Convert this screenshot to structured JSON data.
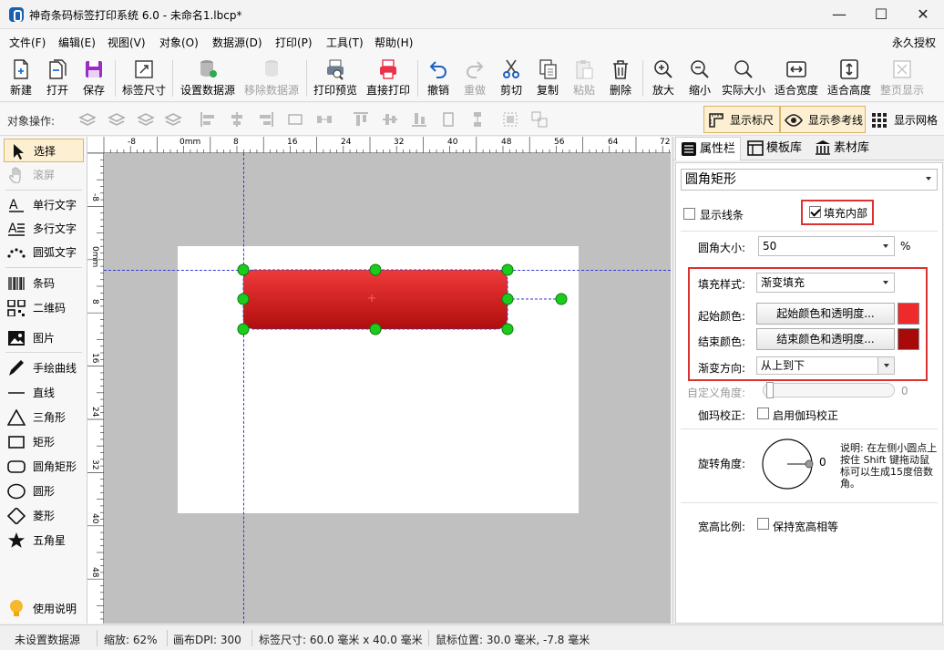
{
  "window": {
    "title": "神奇条码标签打印系统 6.0 - 未命名1.lbcp*",
    "controls": {
      "minimize": "—",
      "maximize": "☐",
      "close": "✕"
    }
  },
  "menu": {
    "items": [
      "文件(F)",
      "编辑(E)",
      "视图(V)",
      "对象(O)",
      "数据源(D)",
      "打印(P)",
      "工具(T)",
      "帮助(H)"
    ],
    "right": "永久授权"
  },
  "toolbar": {
    "buttons": [
      {
        "label": "新建",
        "icon": "new-file-icon",
        "enabled": true
      },
      {
        "label": "打开",
        "icon": "open-file-icon",
        "enabled": true
      },
      {
        "label": "保存",
        "icon": "save-icon",
        "enabled": true
      },
      {
        "label": "标签尺寸",
        "icon": "label-size-icon",
        "enabled": true
      },
      {
        "label": "设置数据源",
        "icon": "database-icon",
        "enabled": true
      },
      {
        "label": "移除数据源",
        "icon": "remove-database-icon",
        "enabled": false
      },
      {
        "label": "打印预览",
        "icon": "print-preview-icon",
        "enabled": true
      },
      {
        "label": "直接打印",
        "icon": "printer-icon",
        "enabled": true
      },
      {
        "label": "撤销",
        "icon": "undo-icon",
        "enabled": true
      },
      {
        "label": "重做",
        "icon": "redo-icon",
        "enabled": false
      },
      {
        "label": "剪切",
        "icon": "scissors-icon",
        "enabled": true
      },
      {
        "label": "复制",
        "icon": "copy-icon",
        "enabled": true
      },
      {
        "label": "粘贴",
        "icon": "paste-icon",
        "enabled": false
      },
      {
        "label": "删除",
        "icon": "trash-icon",
        "enabled": true
      },
      {
        "label": "放大",
        "icon": "zoom-in-icon",
        "enabled": true
      },
      {
        "label": "缩小",
        "icon": "zoom-out-icon",
        "enabled": true
      },
      {
        "label": "实际大小",
        "icon": "zoom-actual-icon",
        "enabled": true
      },
      {
        "label": "适合宽度",
        "icon": "fit-width-icon",
        "enabled": true
      },
      {
        "label": "适合高度",
        "icon": "fit-height-icon",
        "enabled": true
      },
      {
        "label": "整页显示",
        "icon": "fit-page-icon",
        "enabled": false
      }
    ]
  },
  "object_bar": {
    "label": "对象操作:",
    "toggles": [
      {
        "label": "显示标尺",
        "icon": "ruler-icon",
        "active": true
      },
      {
        "label": "显示参考线",
        "icon": "eye-icon",
        "active": true
      },
      {
        "label": "显示网格",
        "icon": "grid-icon",
        "active": false
      }
    ]
  },
  "left_tools": {
    "items": [
      {
        "label": "选择",
        "icon": "pointer-icon",
        "selected": true,
        "enabled": true
      },
      {
        "label": "滚屏",
        "icon": "hand-icon",
        "selected": false,
        "enabled": false
      },
      {
        "label": "单行文字",
        "icon": "single-text-icon",
        "selected": false,
        "enabled": true
      },
      {
        "label": "多行文字",
        "icon": "multi-text-icon",
        "selected": false,
        "enabled": true
      },
      {
        "label": "圆弧文字",
        "icon": "arc-text-icon",
        "selected": false,
        "enabled": true
      },
      {
        "label": "条码",
        "icon": "barcode-icon",
        "selected": false,
        "enabled": true
      },
      {
        "label": "二维码",
        "icon": "qrcode-icon",
        "selected": false,
        "enabled": true
      },
      {
        "label": "图片",
        "icon": "image-icon",
        "selected": false,
        "enabled": true
      },
      {
        "label": "手绘曲线",
        "icon": "pen-icon",
        "selected": false,
        "enabled": true
      },
      {
        "label": "直线",
        "icon": "line-icon",
        "selected": false,
        "enabled": true
      },
      {
        "label": "三角形",
        "icon": "triangle-icon",
        "selected": false,
        "enabled": true
      },
      {
        "label": "矩形",
        "icon": "rectangle-icon",
        "selected": false,
        "enabled": true
      },
      {
        "label": "圆角矩形",
        "icon": "rounded-rectangle-icon",
        "selected": false,
        "enabled": true
      },
      {
        "label": "圆形",
        "icon": "circle-icon",
        "selected": false,
        "enabled": true
      },
      {
        "label": "菱形",
        "icon": "diamond-icon",
        "selected": false,
        "enabled": true
      },
      {
        "label": "五角星",
        "icon": "star-icon",
        "selected": false,
        "enabled": true
      }
    ],
    "help": {
      "label": "使用说明",
      "icon": "lightbulb-icon"
    }
  },
  "ruler": {
    "unit": "mm",
    "h_labels": [
      "-8",
      "0mm",
      "8",
      "16",
      "24",
      "32",
      "40",
      "48",
      "56",
      "64",
      "72"
    ],
    "v_labels": [
      "-8",
      "0mm",
      "8",
      "16",
      "24",
      "32",
      "40",
      "48"
    ]
  },
  "canvas": {
    "shape_gradient_start": "#f03a3a",
    "shape_gradient_end": "#b00d0d"
  },
  "right_panel": {
    "tabs": [
      {
        "label": "属性栏",
        "icon": "properties-icon",
        "active": true
      },
      {
        "label": "模板库",
        "icon": "template-icon",
        "active": false
      },
      {
        "label": "素材库",
        "icon": "library-icon",
        "active": false
      }
    ],
    "object_type": "圆角矩形",
    "show_border": {
      "label": "显示线条",
      "checked": false
    },
    "fill_inside": {
      "label": "填充内部",
      "checked": true
    },
    "corner_size": {
      "label": "圆角大小:",
      "value": "50",
      "unit": "%"
    },
    "fill_style": {
      "label": "填充样式:",
      "value": "渐变填充"
    },
    "start_color": {
      "label": "起始颜色:",
      "button": "起始颜色和透明度...",
      "color": "#ee2a2a"
    },
    "end_color": {
      "label": "结束颜色:",
      "button": "结束颜色和透明度...",
      "color": "#a80a0a"
    },
    "gradient_dir": {
      "label": "渐变方向:",
      "value": "从上到下"
    },
    "custom_angle": {
      "label": "自定义角度:",
      "value": "0"
    },
    "gamma": {
      "label": "伽玛校正:",
      "checkbox": "启用伽玛校正",
      "checked": false
    },
    "rotation": {
      "label": "旋转角度:",
      "value": "0",
      "note": "说明: 在左侧小圆点上按住 Shift 键拖动鼠标可以生成15度倍数角。"
    },
    "aspect": {
      "label": "宽高比例:",
      "checkbox": "保持宽高相等",
      "checked": false
    }
  },
  "status": {
    "datasource": "未设置数据源",
    "zoom": "缩放: 62%",
    "dpi": "画布DPI: 300",
    "label_size": "标签尺寸: 60.0 毫米 x 40.0 毫米",
    "mouse_pos": "鼠标位置: 30.0 毫米, -7.8 毫米"
  }
}
